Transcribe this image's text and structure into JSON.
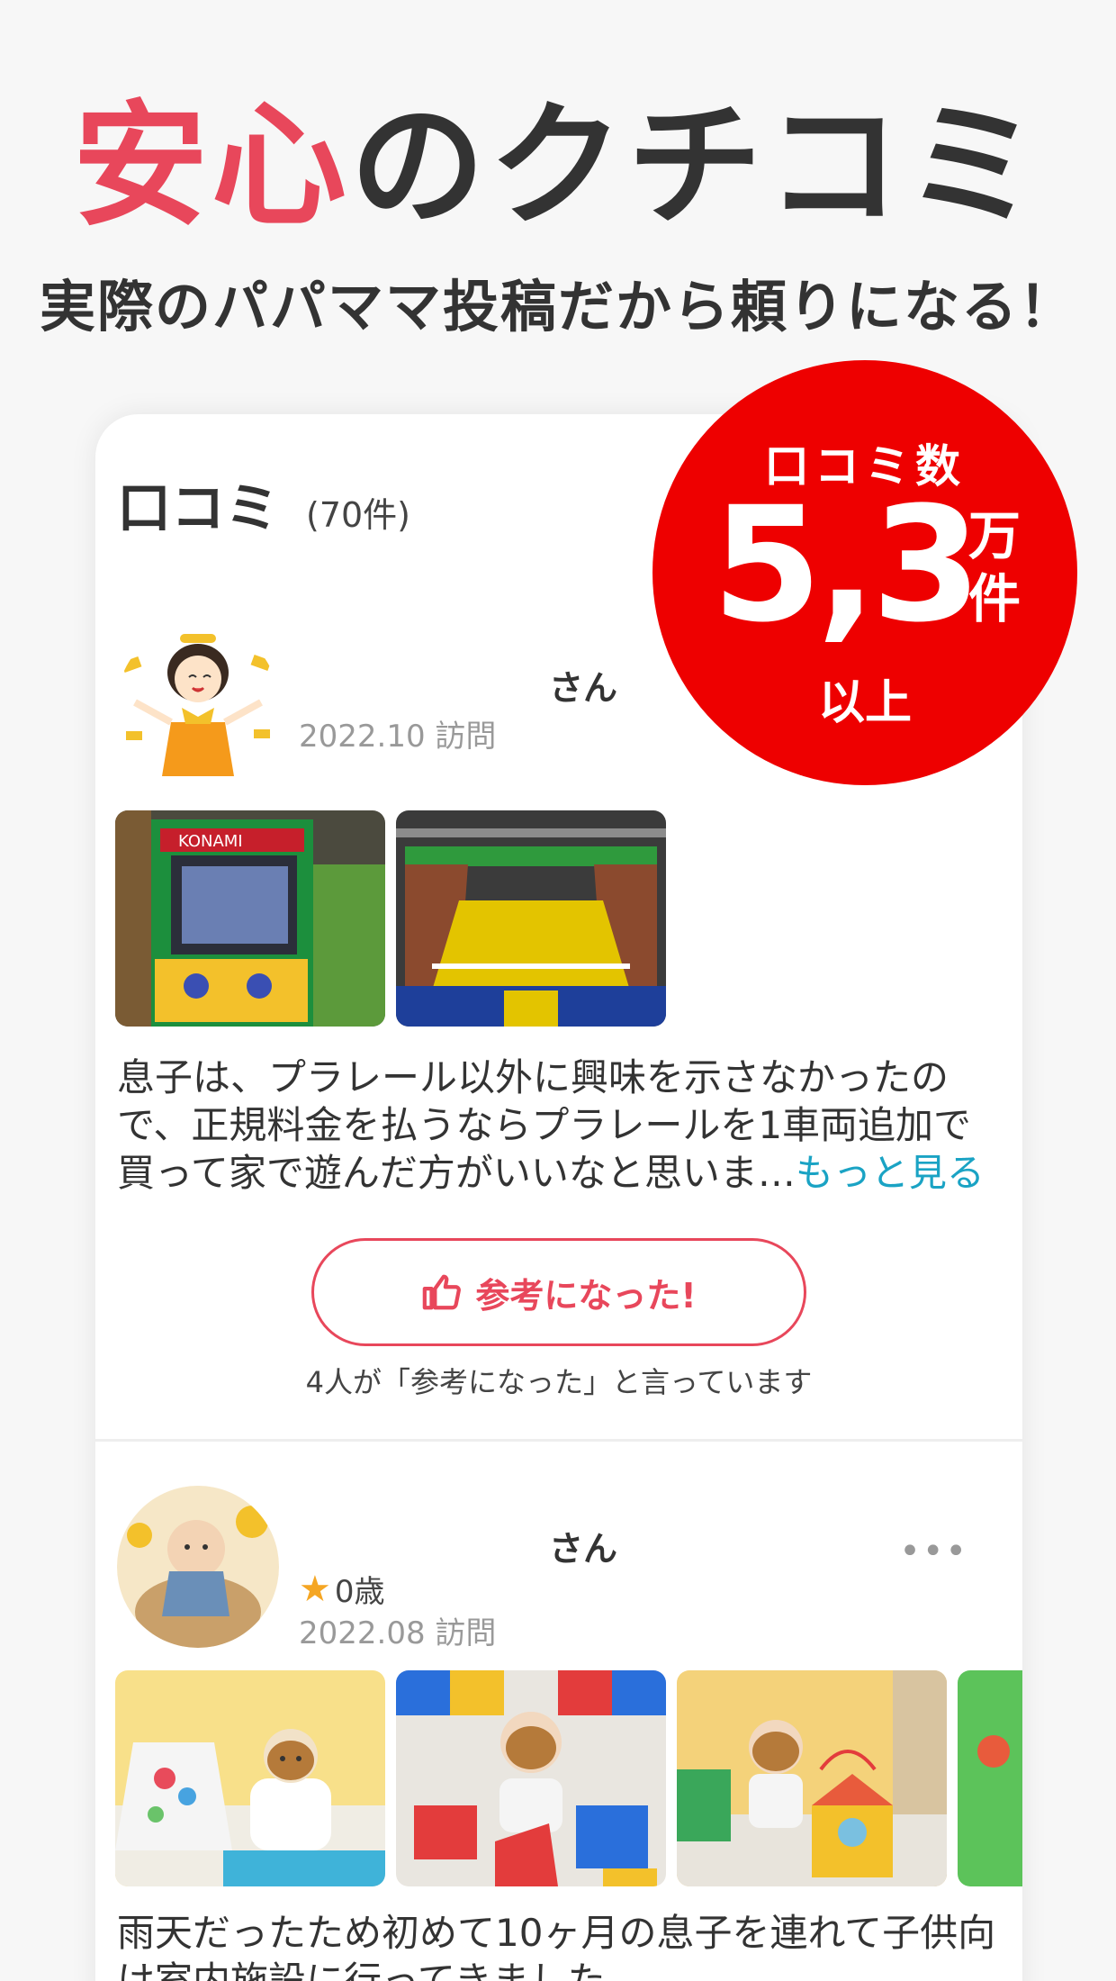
{
  "headline": {
    "accent": "安心",
    "rest": "のクチコミ"
  },
  "subheadline": "実際のパパママ投稿だから頼りになる！",
  "badge": {
    "line1": "口コミ数",
    "number": "5,3",
    "unit1": "万",
    "unit2": "件",
    "line3": "以上"
  },
  "reviews_section": {
    "title": "口コミ",
    "count": "(70件)"
  },
  "reviews": [
    {
      "name_suffix": "さん",
      "visit": "2022.10 訪問",
      "text_line1": "息子は、プラレール以外に興味を示さなかったの",
      "text_line2": "で、正規料金を払うならプラレールを1車両追加で",
      "text_line3": "買って家で遊んだ方がいいなと思いま…",
      "more": "もっと見る",
      "helpful_button": "参考になった!",
      "helpful_count": "4人が「参考になった」と言っています"
    },
    {
      "name_suffix": "さん",
      "age": "0歳",
      "visit": "2022.08 訪問",
      "menu": "•••",
      "text_line1": "雨天だったため初めて10ヶ月の息子を連れて子供向",
      "text_line2": "け室内施設に行ってきました。"
    }
  ],
  "colors": {
    "accent": "#e8475b",
    "badge": "#ee0000",
    "link": "#1aa3c4",
    "star": "#f5a623"
  }
}
